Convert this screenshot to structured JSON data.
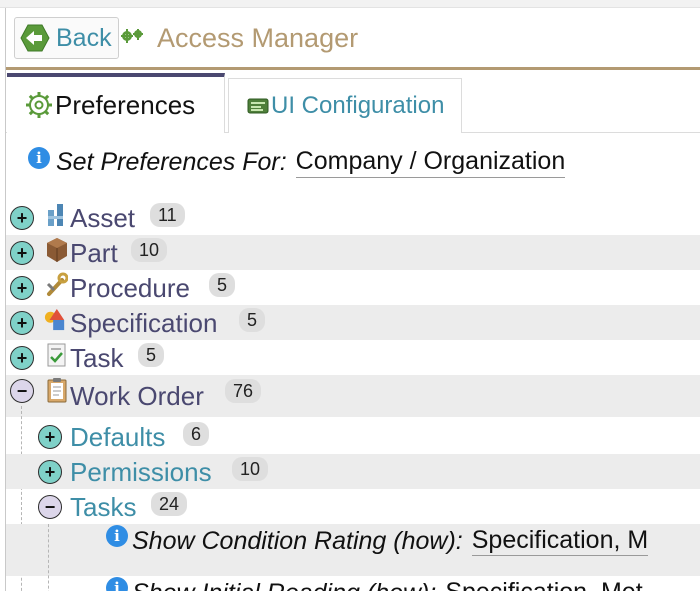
{
  "header": {
    "back_label": "Back",
    "title": "Access Manager"
  },
  "tabs": [
    {
      "label": "Preferences",
      "active": true
    },
    {
      "label": "UI Configuration",
      "active": false
    }
  ],
  "preferences_for": {
    "label": "Set Preferences For:",
    "value": "Company / Organization"
  },
  "tree": [
    {
      "name": "Asset",
      "count": "11",
      "expanded": false,
      "icon": "asset-icon"
    },
    {
      "name": "Part",
      "count": "10",
      "expanded": false,
      "icon": "part-box-icon"
    },
    {
      "name": "Procedure",
      "count": "5",
      "expanded": false,
      "icon": "procedure-wrench-icon"
    },
    {
      "name": "Specification",
      "count": "5",
      "expanded": false,
      "icon": "specification-shapes-icon"
    },
    {
      "name": "Task",
      "count": "5",
      "expanded": false,
      "icon": "task-checklist-icon"
    },
    {
      "name": "Work Order",
      "count": "76",
      "expanded": true,
      "icon": "work-order-clipboard-icon",
      "children": [
        {
          "name": "Defaults",
          "count": "6",
          "expanded": false
        },
        {
          "name": "Permissions",
          "count": "10",
          "expanded": false
        },
        {
          "name": "Tasks",
          "count": "24",
          "expanded": true
        }
      ]
    }
  ],
  "task_settings": [
    {
      "label": "Show Condition Rating (how):",
      "value": "Specification, M"
    },
    {
      "label": "Show Initial Reading (how):",
      "value": "Specification, Met"
    }
  ],
  "colors": {
    "accent_gold": "#b39a72",
    "link_teal": "#3e8ea7",
    "tree_text": "#4a4870",
    "expand_green": "#7fd1c8"
  }
}
